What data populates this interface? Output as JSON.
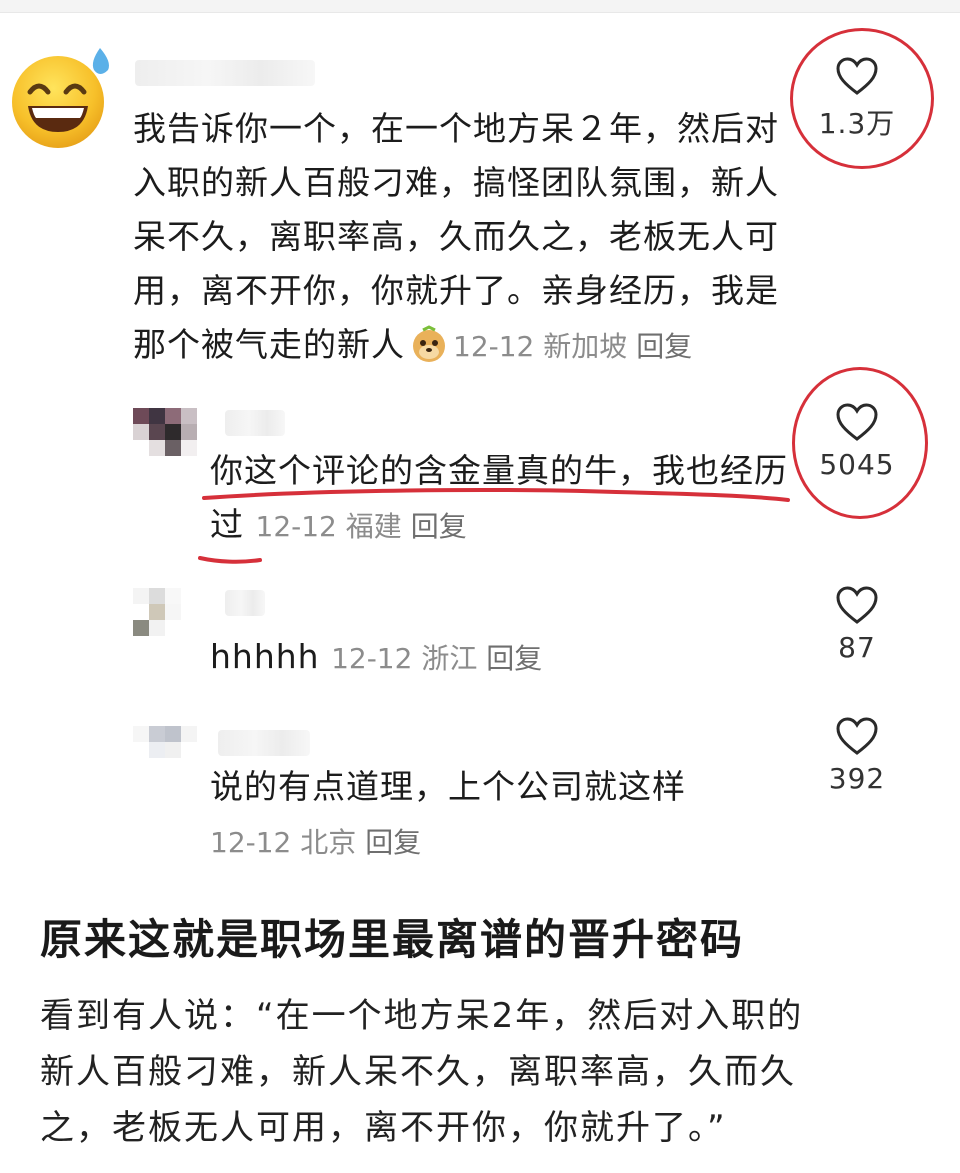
{
  "comments": [
    {
      "text_lines": [
        "我告诉你一个，在一个地方呆２年，然后对",
        "入职的新人百般刁难，搞怪团队氛围，新人",
        "呆不久，离职率高，久而久之，老板无人可",
        "用，离不开你，你就升了。亲身经历，我是",
        "那个被气走的新人"
      ],
      "date": "12-12",
      "location": "新加坡",
      "reply": "回复",
      "likes": "1.3万"
    },
    {
      "text_lines": [
        "你这个评论的含金量真的牛，我也经历",
        "过"
      ],
      "date": "12-12",
      "location": "福建",
      "reply": "回复",
      "likes": "5045"
    },
    {
      "text": "hhhhh",
      "date": "12-12",
      "location": "浙江",
      "reply": "回复",
      "likes": "87"
    },
    {
      "text": "说的有点道理，上个公司就这样",
      "date": "12-12",
      "location": "北京",
      "reply": "回复",
      "likes": "392"
    }
  ],
  "article": {
    "title": "原来这就是职场里最离谱的晋升密码",
    "body_lines": [
      "看到有人说：“在一个地方呆2年，然后对入职的",
      "新人百般刁难，新人呆不久，离职率高，久而久",
      "之，老板无人可用，离不开你，你就升了。”"
    ]
  },
  "colors": {
    "annotation_red": "#d6303a",
    "meta_gray": "#8c8c8c"
  },
  "icons": [
    "grinning-sweat-emoji-avatar",
    "heart-outline-icon",
    "meerkat-emoji"
  ]
}
